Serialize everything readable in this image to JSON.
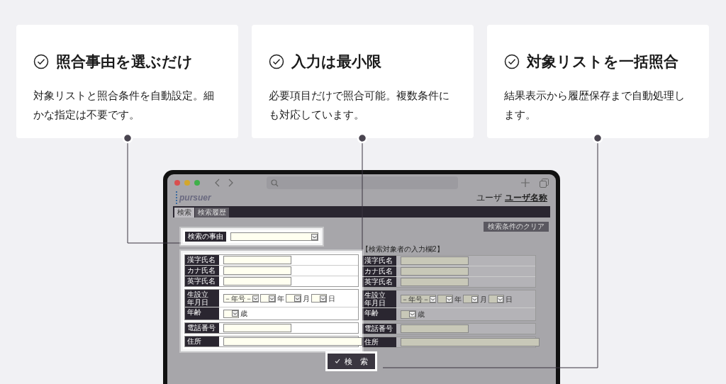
{
  "features": [
    {
      "title": "照合事由を選ぶだけ",
      "description": "対象リストと照合条件を自動設定。細かな指定は不要です。"
    },
    {
      "title": "入力は最小限",
      "description": "必要項目だけで照合可能。複数条件にも対応しています。"
    },
    {
      "title": "対象リストを一括照合",
      "description": "結果表示から履歴保存まで自動処理します。"
    }
  ],
  "app": {
    "logo": "pursuer",
    "user_label": "ユーザ",
    "user_name": "ユーザ名称",
    "tabs": [
      {
        "label": "検索",
        "selected": true
      },
      {
        "label": "検索履歴",
        "selected": false
      }
    ],
    "clear_button": "検索条件のクリア",
    "reason": {
      "label": "検索の事由",
      "highlighted": true
    },
    "panels": [
      {
        "highlighted": true,
        "groups": [
          [
            {
              "kind": "text",
              "label": "漢字氏名"
            },
            {
              "kind": "text",
              "label": "カナ氏名"
            },
            {
              "kind": "text",
              "label": "英字氏名"
            }
          ],
          [
            {
              "kind": "date",
              "label": "生設立年月日",
              "era": "－年号－",
              "units": [
                "年",
                "月",
                "日"
              ]
            },
            {
              "kind": "age",
              "label": "年齢",
              "unit": "歳"
            }
          ],
          [
            {
              "kind": "text",
              "label": "電話番号"
            }
          ],
          [
            {
              "kind": "wide",
              "label": "住所"
            }
          ]
        ]
      },
      {
        "heading": "【検索対象者の入力欄2】",
        "highlighted": false,
        "groups": [
          [
            {
              "kind": "text",
              "label": "漢字氏名"
            },
            {
              "kind": "text",
              "label": "カナ氏名"
            },
            {
              "kind": "text",
              "label": "英字氏名"
            }
          ],
          [
            {
              "kind": "date",
              "label": "生設立年月日",
              "era": "－年号－",
              "units": [
                "年",
                "月",
                "日"
              ]
            },
            {
              "kind": "age",
              "label": "年齢",
              "unit": "歳"
            }
          ],
          [
            {
              "kind": "text",
              "label": "電話番号"
            }
          ],
          [
            {
              "kind": "wide",
              "label": "住所"
            }
          ]
        ]
      }
    ],
    "search_button": {
      "label": "検　索",
      "highlighted": true
    }
  }
}
